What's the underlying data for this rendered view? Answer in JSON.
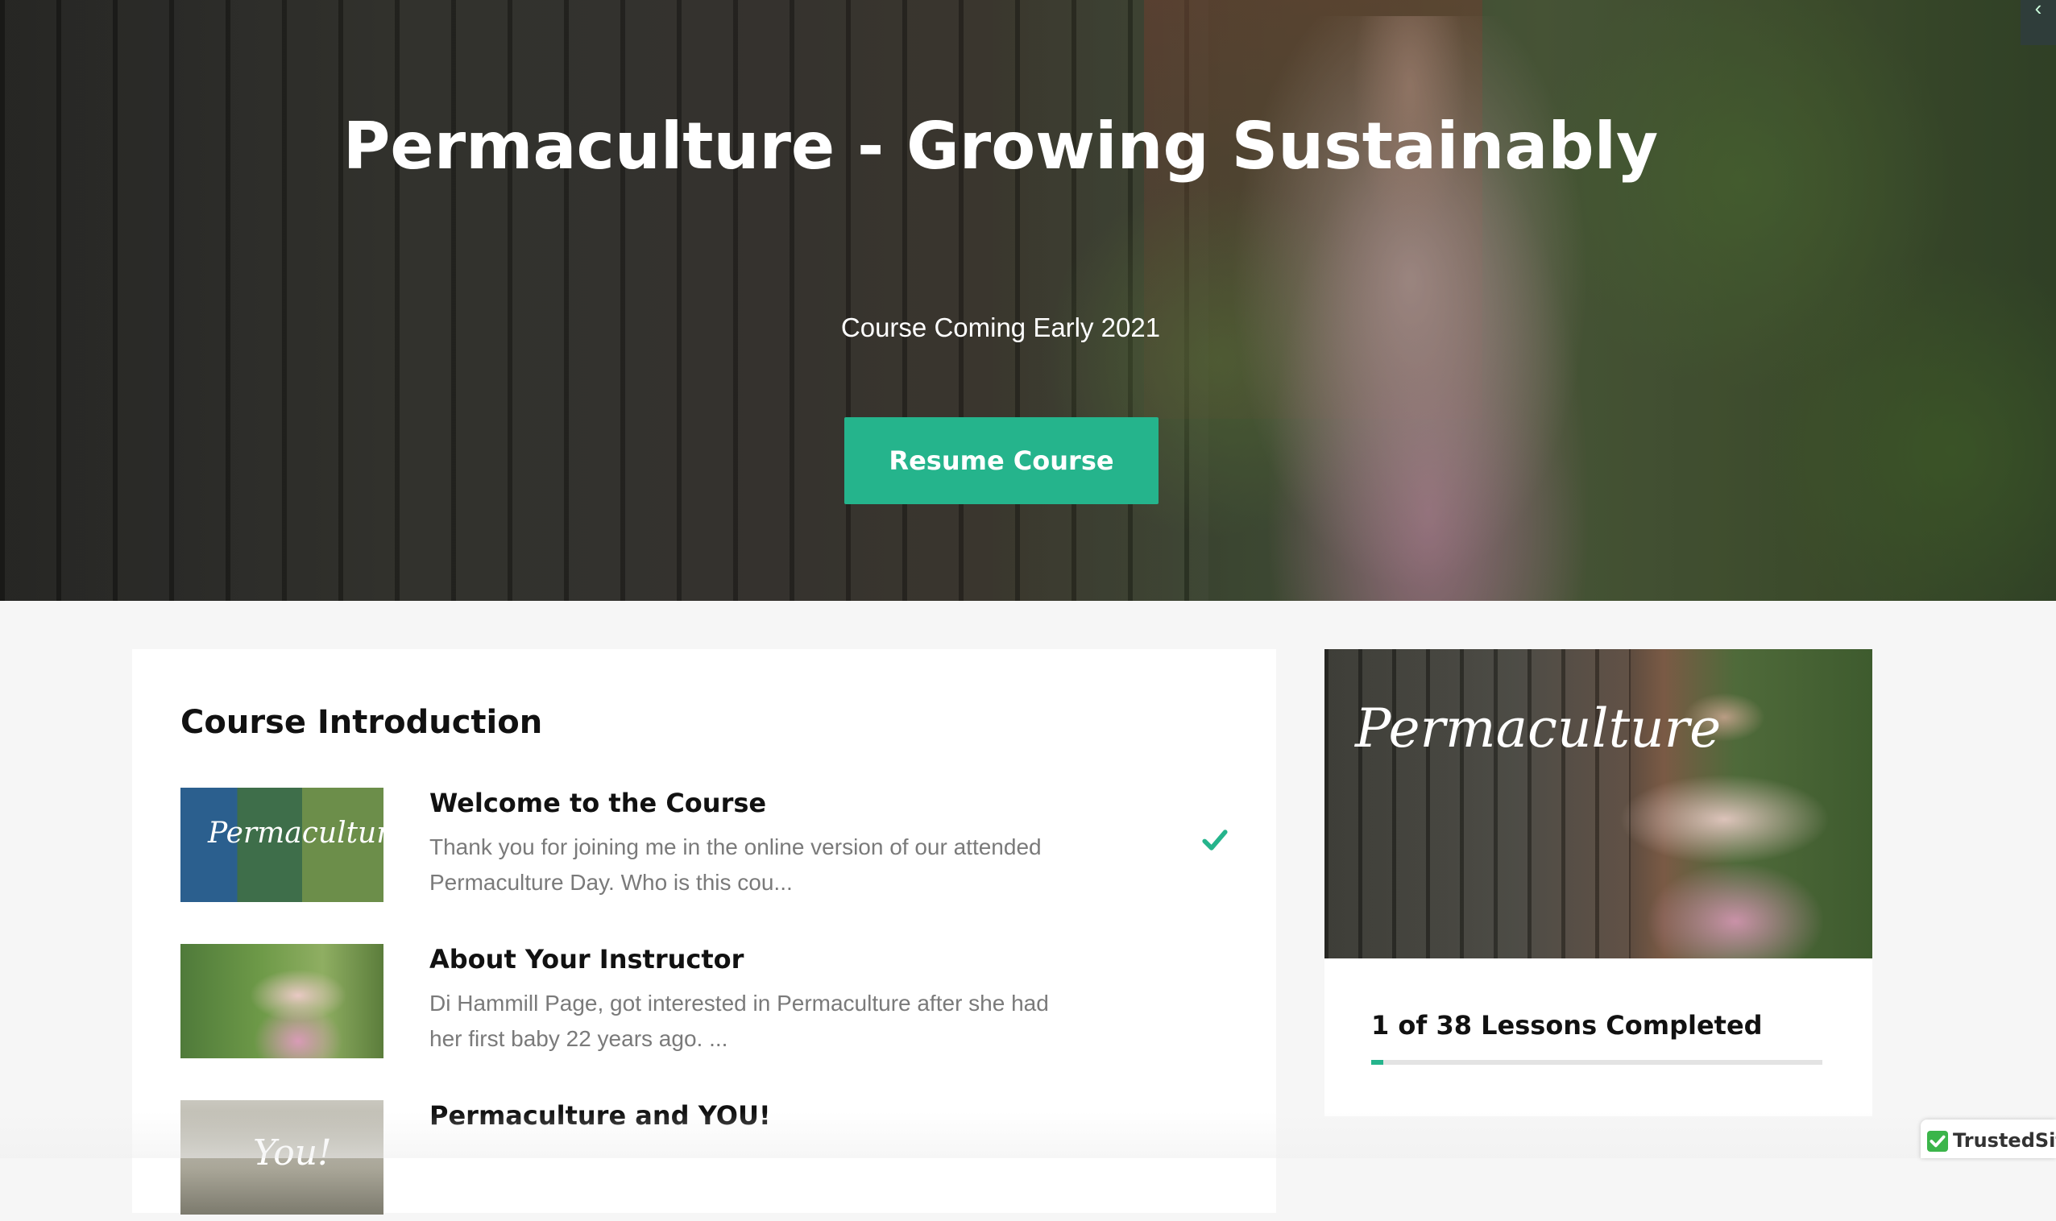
{
  "hero": {
    "title": "Permaculture - Growing Sustainably",
    "subtitle": "Course Coming Early 2021",
    "resume_label": "Resume Course",
    "corner_glyph": "‹"
  },
  "main": {
    "section_title": "Course Introduction",
    "lessons": [
      {
        "title": "Welcome to the Course",
        "description": "Thank you for joining me in the online version of our attended Permaculture Day. Who is this cou...",
        "thumb_text": "Permaculture",
        "completed": true
      },
      {
        "title": "About Your Instructor",
        "description": "Di Hammill Page, got interested in Permaculture after she had her first baby 22 years ago.  ...",
        "thumb_text": "",
        "completed": false
      },
      {
        "title": "Permaculture and YOU!",
        "description": "",
        "thumb_text": "You!",
        "completed": false
      }
    ]
  },
  "side": {
    "image_text": "Permaculture",
    "progress_label": "1 of 38 Lessons Completed",
    "completed": 1,
    "total": 38
  },
  "badge": {
    "name": "TrustedSite"
  },
  "colors": {
    "accent": "#25b48c",
    "badge_green": "#3bb54a"
  },
  "icons": [
    "check-icon",
    "chevron-left-icon",
    "trustedsite-check-icon"
  ]
}
